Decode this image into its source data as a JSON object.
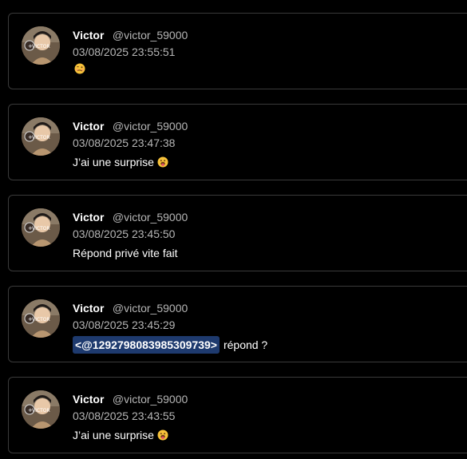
{
  "posts": [
    {
      "name": "Victor",
      "handle": "@victor_59000",
      "timestamp": "03/08/2025 23:55:51",
      "text": "",
      "mention": "",
      "emoji": "woozy-face"
    },
    {
      "name": "Victor",
      "handle": "@victor_59000",
      "timestamp": "03/08/2025 23:47:38",
      "text": "J’ai une surprise",
      "mention": "",
      "emoji": "face-with-tongue"
    },
    {
      "name": "Victor",
      "handle": "@victor_59000",
      "timestamp": "03/08/2025 23:45:50",
      "text": "Répond privé vite fait",
      "mention": "",
      "emoji": ""
    },
    {
      "name": "Victor",
      "handle": "@victor_59000",
      "timestamp": "03/08/2025 23:45:29",
      "text": "répond ?",
      "mention": "<@1292798083985309739>",
      "emoji": ""
    },
    {
      "name": "Victor",
      "handle": "@victor_59000",
      "timestamp": "03/08/2025 23:43:55",
      "text": "J’ai une surprise",
      "mention": "",
      "emoji": "face-with-tongue"
    }
  ],
  "colors": {
    "background": "#000000",
    "card_border": "#3a3a3a",
    "muted_text": "#b5b5b5",
    "mention_bg": "#1e3a6e",
    "emoji_yellow": "#f7c23a"
  }
}
